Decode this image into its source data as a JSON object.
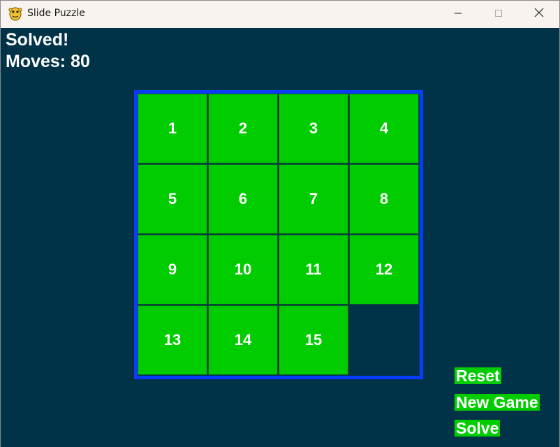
{
  "window": {
    "title": "Slide Puzzle"
  },
  "hud": {
    "status": "Solved!",
    "moves_label": "Moves:",
    "moves_value": "80"
  },
  "board": {
    "tiles": [
      {
        "label": "1"
      },
      {
        "label": "2"
      },
      {
        "label": "3"
      },
      {
        "label": "4"
      },
      {
        "label": "5"
      },
      {
        "label": "6"
      },
      {
        "label": "7"
      },
      {
        "label": "8"
      },
      {
        "label": "9"
      },
      {
        "label": "10"
      },
      {
        "label": "11"
      },
      {
        "label": "12"
      },
      {
        "label": "13"
      },
      {
        "label": "14"
      },
      {
        "label": "15"
      },
      {
        "label": ""
      }
    ]
  },
  "buttons": {
    "reset": "Reset",
    "new_game": "New Game",
    "solve": "Solve"
  },
  "colors": {
    "background": "#003348",
    "tile": "#00cc00",
    "board_border": "#0a3cff",
    "text": "#ffffff"
  }
}
